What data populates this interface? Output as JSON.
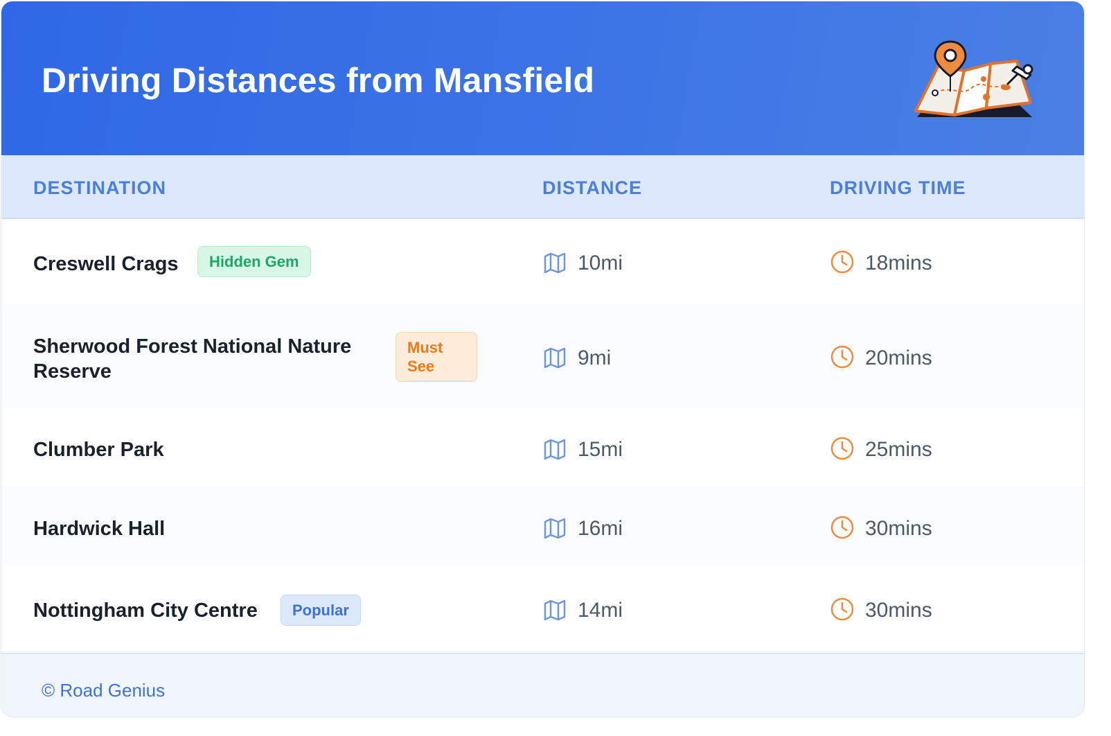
{
  "header": {
    "title": "Driving Distances from Mansfield",
    "illustration": "map-with-pins-icon"
  },
  "columns": {
    "destination": "DESTINATION",
    "distance": "DISTANCE",
    "driving_time": "DRIVING TIME"
  },
  "rows": [
    {
      "destination": "Creswell Crags",
      "badge": "Hidden Gem",
      "badge_color": "#1ba868",
      "distance": "10mi",
      "time": "18mins"
    },
    {
      "destination_line1": "Sherwood Forest National Nature",
      "destination_line2": "Reserve",
      "badge_line1": "Must",
      "badge_line2": "See",
      "badge_color": "#ee7a15",
      "distance": "9mi",
      "time": "20mins"
    },
    {
      "destination": "Clumber Park",
      "distance": "15mi",
      "time": "25mins"
    },
    {
      "destination": "Hardwick Hall",
      "distance": "16mi",
      "time": "30mins"
    },
    {
      "destination": "Nottingham City Centre",
      "badge": "Popular",
      "badge_color": "#3f72d6",
      "distance": "14mi",
      "time": "30mins"
    }
  ],
  "icons": {
    "distance": "map-icon",
    "time": "clock-icon"
  },
  "colors": {
    "header_start": "#2f68e6",
    "header_end": "#4a80e4",
    "column_header_text": "#4a7fdc",
    "icon_map": "#6f95dd",
    "icon_clock": "#f08a3c"
  },
  "footer": {
    "credit": "© Road Genius"
  }
}
